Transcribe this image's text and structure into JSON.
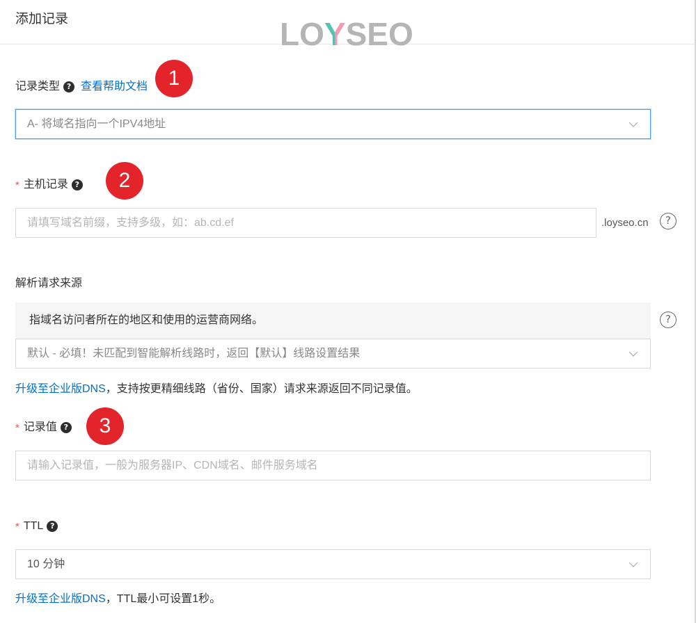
{
  "header": {
    "title": "添加记录"
  },
  "watermark": {
    "prefix": "LO",
    "highlight": "Y",
    "suffix": "SEO"
  },
  "colors": {
    "link": "#0070cc",
    "marker": "#e3242b",
    "required": "#f0504a",
    "focus_border": "#4a9fe6"
  },
  "icons": {
    "help_filled": "question-icon",
    "help_outline": "help-circle-icon",
    "dropdown": "chevron-down-icon"
  },
  "form": {
    "record_type": {
      "label": "记录类型",
      "help_link": "查看帮助文档",
      "selected": "A- 将域名指向一个IPV4地址",
      "focused": true,
      "marker": "1"
    },
    "host": {
      "required_mark": "*",
      "label": "主机记录",
      "placeholder": "请填写域名前缀，支持多级，如：ab.cd.ef",
      "value": "",
      "suffix": ".loyseo.cn",
      "marker": "2"
    },
    "source": {
      "label": "解析请求来源",
      "description": "指域名访问者所在的地区和使用的运营商网络。",
      "selected": "默认 - 必填！未匹配到智能解析线路时，返回【默认】线路设置结果",
      "upgrade_link": "升级至企业版DNS",
      "upgrade_note": "，支持按更精细线路（省份、国家）请求来源返回不同记录值。"
    },
    "value": {
      "required_mark": "*",
      "label": "记录值",
      "placeholder": "请输入记录值，一般为服务器IP、CDN域名、邮件服务域名",
      "value": "",
      "marker": "3"
    },
    "ttl": {
      "required_mark": "*",
      "label": "TTL",
      "selected": "10 分钟",
      "upgrade_link": "升级至企业版DNS",
      "upgrade_note": "，TTL最小可设置1秒。"
    }
  }
}
